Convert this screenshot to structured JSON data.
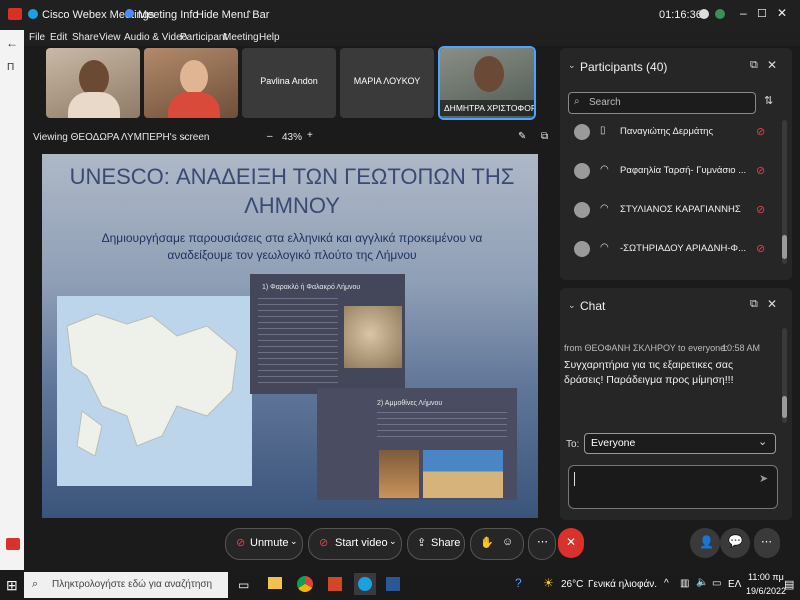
{
  "titlebar": {
    "app_title": "Cisco Webex Meetings",
    "meeting_info": "Meeting Info",
    "hide_menu_bar": "Hide Menu Bar",
    "timer": "01:16:36"
  },
  "menu": [
    "File",
    "Edit",
    "Share",
    "View",
    "Audio & Video",
    "Participant",
    "Meeting",
    "Help"
  ],
  "videos": [
    {
      "name": ""
    },
    {
      "name": ""
    },
    {
      "name": "Pavlina Andon"
    },
    {
      "name": "ΜΑΡΙΑ ΛΟΥΚΟΥ"
    },
    {
      "name": "ΔΗΜΗΤΡΑ ΧΡΙΣΤΟΦΟΡΙ..."
    }
  ],
  "share": {
    "viewing": "Viewing ΘΕΟΔΩΡΑ ΛΥΜΠΕΡΗ's screen",
    "zoom": "43%"
  },
  "slide": {
    "title": "UNESCO: ΑΝΑΔΕΙΞΗ ΤΩΝ ΓΕΩΤΟΠΩΝ ΤΗΣ ΛΗΜΝΟΥ",
    "subtitle": "Δημιουργήσαμε παρουσιάσεις στα ελληνικά και αγγλικά προκειμένου να αναδείξουμε τον γεωλογικό πλούτο της Λήμνου",
    "card1_title": "1) Φαρακλό ή Φαλακρό Λήμνου",
    "card2_title": "2) Αμμοθίνες Λήμνου"
  },
  "participants": {
    "title": "Participants (40)",
    "search_placeholder": "Search",
    "list": [
      {
        "name": "Παναγιώτης Δερμάτης"
      },
      {
        "name": "Ραφαηλία Ταρσή- Γυμνάσιο ..."
      },
      {
        "name": "ΣΤΥΛΙΑΝΟΣ ΚΑΡΑΓΙΑΝΝΗΣ"
      },
      {
        "name": "-ΣΩΤΗΡΙΑΔΟΥ ΑΡΙΑΔΝΗ-Φ..."
      }
    ]
  },
  "chat": {
    "title": "Chat",
    "message_header": "from ΘΕΟΦΑΝΗ ΣΚΛΗΡΟΥ to everyone:",
    "message_time": "10:58 AM",
    "message_text": "Συγχαρητήρια για τις εξαιρετικες σας δράσεις! Παράδειγμα προς μίμηση!!!",
    "to_label": "To:",
    "recipient": "Everyone"
  },
  "controls": {
    "unmute": "Unmute",
    "start_video": "Start video",
    "share": "Share"
  },
  "taskbar": {
    "search_placeholder": "Πληκτρολογήστε εδώ για αναζήτηση",
    "weather_temp": "26°C",
    "weather_desc": "Γενικά ηλιοφάν.",
    "language": "ΕΛ",
    "time": "11:00 πμ",
    "date": "19/6/2022"
  },
  "colors": {
    "accent_blue": "#1f5fd6",
    "mute_red": "#e0404a",
    "leave_red": "#d9312b"
  }
}
